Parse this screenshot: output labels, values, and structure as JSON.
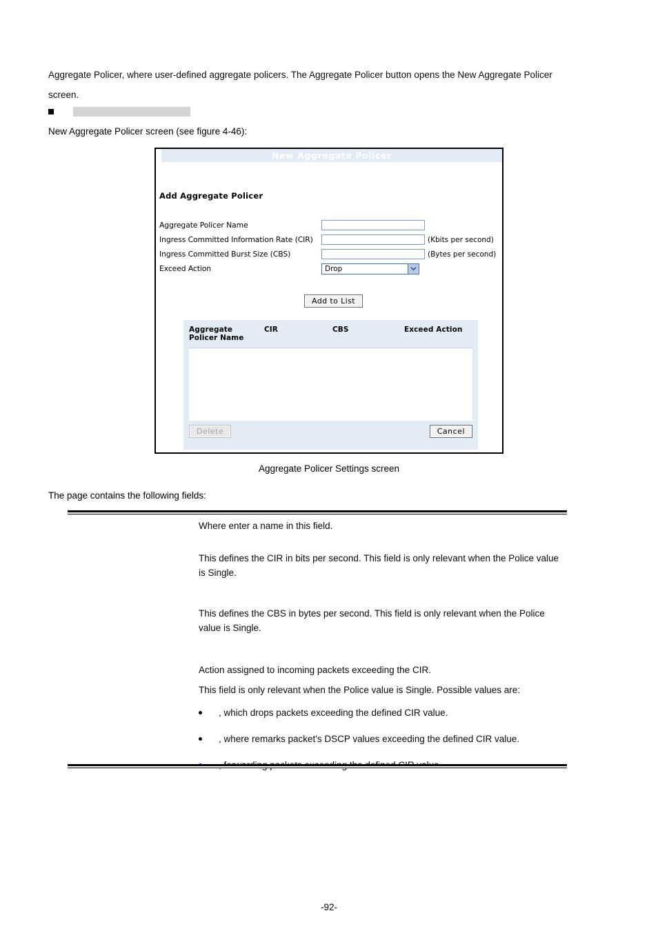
{
  "document": {
    "intro_line_1": "Aggregate Policer, where user-defined aggregate policers. The Aggregate Policer button opens the New Aggregate Policer",
    "intro_line_2": "screen.",
    "redacted_bullet_label": "",
    "figure_reference": "New Aggregate Policer screen (see figure 4-46):",
    "figure_caption": "Aggregate Policer Settings screen",
    "fields_intro": "The page contains the following fields:",
    "page_number": "-92-"
  },
  "screenshot": {
    "title": "New Aggregate Policer",
    "section_heading": "Add Aggregate Policer",
    "fields": [
      {
        "label": "Aggregate Policer Name",
        "value": "",
        "unit": ""
      },
      {
        "label": "Ingress Committed Information Rate (CIR)",
        "value": "",
        "unit": "(Kbits per second)"
      },
      {
        "label": "Ingress Committed Burst Size (CBS)",
        "value": "",
        "unit": "(Bytes per second)"
      }
    ],
    "exceed_action": {
      "label": "Exceed Action",
      "selected": "Drop"
    },
    "add_to_list_label": "Add to List",
    "table": {
      "headers": {
        "name": "Aggregate\nPolicer Name",
        "name_line1": "Aggregate",
        "name_line2": "Policer Name",
        "cir": "CIR",
        "cbs": "CBS",
        "exceed_action": "Exceed Action"
      },
      "rows": []
    },
    "delete_label": "Delete",
    "cancel_label": "Cancel"
  },
  "definitions": [
    {
      "term": "",
      "description": "Where enter a name in this field."
    },
    {
      "term": "",
      "description": "This defines the CIR in bits per second. This field is only relevant when the Police value is Single."
    },
    {
      "term": "",
      "description": "This defines the CBS in bytes per second. This field is only relevant when the Police value is Single."
    },
    {
      "term": "",
      "description": "Action assigned to incoming packets exceeding the CIR.",
      "description_2": "This field is only relevant when the Police value is Single. Possible values are:"
    }
  ],
  "exceed_action_values": [
    {
      "name": "",
      "text": ", which drops packets exceeding the defined CIR value.",
      "bullet_color": "#000000"
    },
    {
      "name": "",
      "text": ", where remarks packet's DSCP values exceeding the defined CIR value.",
      "bullet_color": "#000000"
    },
    {
      "name": "",
      "text": ", forwarding packets exceeding the defined CIR value.",
      "bullet_color": "#2020d0"
    }
  ]
}
